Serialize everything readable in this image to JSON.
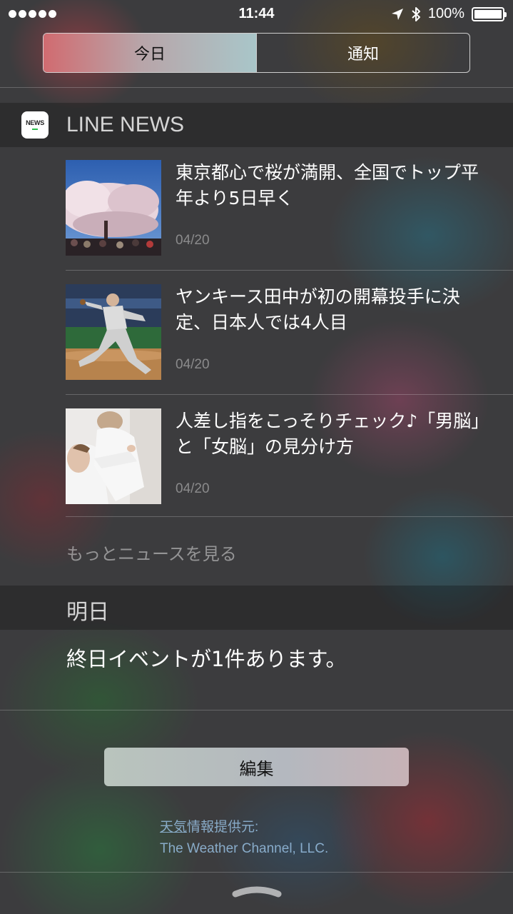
{
  "status_bar": {
    "time": "11:44",
    "battery": "100%",
    "battery_level": 1.0,
    "icons": [
      "signal-dots-icon",
      "location-arrow-icon",
      "bluetooth-icon",
      "battery-icon"
    ]
  },
  "segment": {
    "tabs": [
      {
        "label": "今日",
        "active": true
      },
      {
        "label": "通知",
        "active": false
      }
    ]
  },
  "news_widget": {
    "app_name": "LINE NEWS",
    "app_icon_text": "NEWS",
    "items": [
      {
        "title": "東京都心で桜が満開、全国でトップ平年より5日早く",
        "date": "04/20",
        "thumbnail": "cherry-blossom-photo"
      },
      {
        "title": "ヤンキース田中が初の開幕投手に決定、日本人では4人目",
        "date": "04/20",
        "thumbnail": "baseball-pitcher-photo"
      },
      {
        "title": "人差し指をこっそりチェック♪「男脳」と「女脳」の見分け方",
        "date": "04/20",
        "thumbnail": "couple-photo"
      }
    ],
    "more_label": "もっとニュースを見る"
  },
  "tomorrow_widget": {
    "title": "明日",
    "event_text": "終日イベントが1件あります。"
  },
  "edit_button": {
    "label": "編集"
  },
  "attribution": {
    "link_text": "天気",
    "rest_text": "情報提供元:",
    "provider": "The Weather Channel, LLC."
  },
  "colors": {
    "active_tab_start": "#d16b70",
    "active_tab_end": "#a9c6c9",
    "attribution_link": "#96bee1"
  }
}
